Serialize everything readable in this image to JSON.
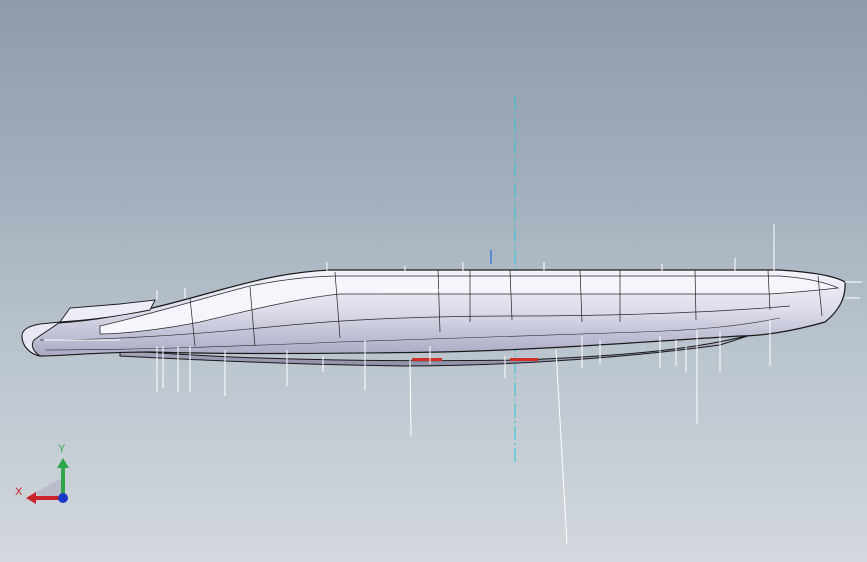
{
  "viewport": {
    "background_top": "#8d9bab",
    "background_bottom": "#d2d8dd"
  },
  "model": {
    "body_color": "#dcdcec",
    "edge_color": "#1a1a1a",
    "highlight_color": "#f2f2fb",
    "accent_color": "#d0302a"
  },
  "axis_line": {
    "color": "#2ec4d8"
  },
  "triad": {
    "y_label": "Y",
    "x_label": "X",
    "y_color": "#2fa64a",
    "x_color": "#c8222a",
    "z_color": "#1c38c8",
    "icons": [
      "y-axis-arrow-icon",
      "x-axis-arrow-icon",
      "z-axis-dot-icon"
    ]
  }
}
